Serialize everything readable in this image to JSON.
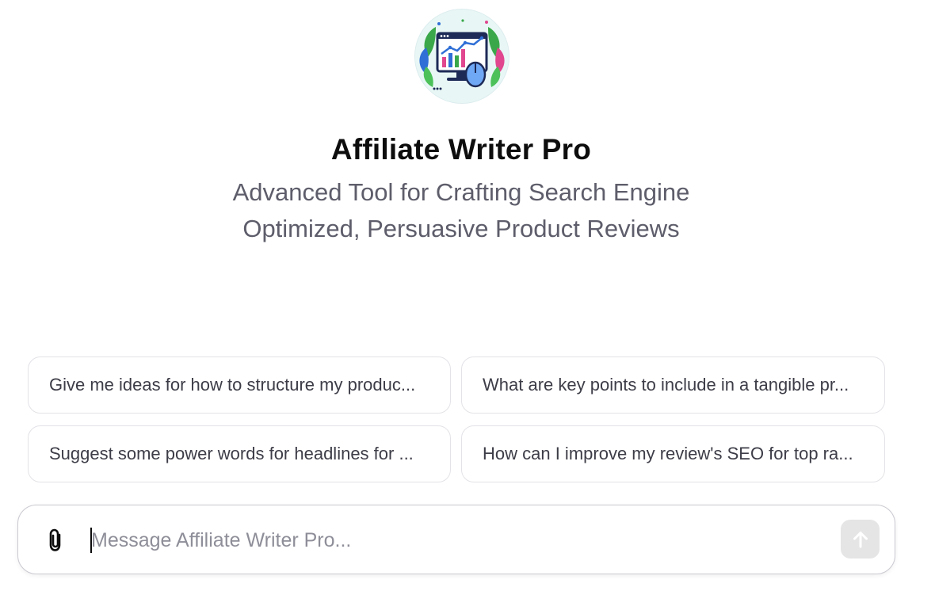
{
  "gpt": {
    "name": "Affiliate Writer Pro",
    "description_line1": "Advanced Tool for Crafting Search Engine",
    "description_line2": "Optimized, Persuasive Product Reviews",
    "avatar_icon": "analytics-monitor-leaves-icon"
  },
  "suggestions": [
    {
      "label": "Give me ideas for how to structure my produc..."
    },
    {
      "label": "What are key points to include in a tangible pr..."
    },
    {
      "label": "Suggest some power words for headlines for ..."
    },
    {
      "label": "How can I improve my review's SEO for top ra..."
    }
  ],
  "composer": {
    "placeholder": "Message Affiliate Writer Pro...",
    "value": "",
    "attach_icon": "paperclip-icon",
    "send_icon": "arrow-up-icon"
  },
  "colors": {
    "title": "#0d0d0d",
    "subtitle": "#5d5d6b",
    "chip_border": "#e3e3e8",
    "send_disabled_bg": "#e5e5e5",
    "placeholder": "#8e8e99"
  }
}
